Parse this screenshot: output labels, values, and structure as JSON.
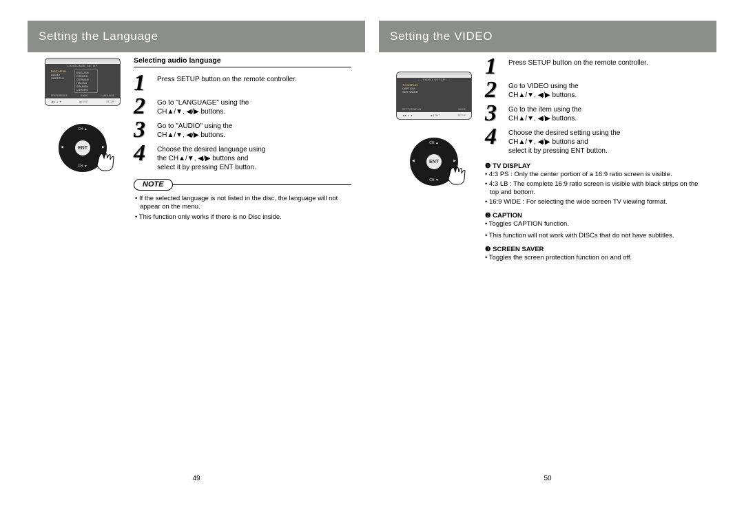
{
  "left": {
    "title": "Setting the Language",
    "screenTitle": "LANGUAGE SETUP",
    "screenMenu": [
      "DISC MENU",
      "AUDIO",
      "SUBTITLE"
    ],
    "screenSub": [
      "ENGLISH",
      "FRENCH",
      "GERMAN",
      "ITALIAN",
      "SPANISH",
      "OTHERS"
    ],
    "screenFoot": [
      "PREFERENCE",
      "AUDIO",
      "LANGUAGE"
    ],
    "screenFoot2Left": "◀ ▶ ▲ ▼",
    "screenFoot2Mid": "▶II  ENT",
    "screenFoot2Right": "SETUP",
    "dpadEnt": "ENT",
    "dpadUp": "CH ▲",
    "dpadDn": "CH ▼",
    "dpadLf": "◀",
    "dpadRt": "▶",
    "selHeading": "Selecting audio language",
    "step1": "Press SETUP button on the remote controller.",
    "step2a": "Go to \"LANGUAGE\" using the",
    "step2b": "CH▲/▼, ◀/▶  buttons.",
    "step3a": "Go to \"AUDIO\" using the",
    "step3b": "CH▲/▼, ◀/▶  buttons.",
    "step4a": "Choose the desired language using",
    "step4b": "the  CH▲/▼, ◀/▶  buttons and",
    "step4c": "select it by  pressing  ENT  button.",
    "noteLabel": "NOTE",
    "note1": "If the selected language is not listed in the disc, the language will not appear on the menu.",
    "note2": "This function only works if there is no Disc inside.",
    "pageNum": "49"
  },
  "right": {
    "title": "Setting the VIDEO",
    "screenTitle": "- - VIDEO SETUP - -",
    "screenMenu": [
      "TV DISPLAY",
      "CAPTION",
      "SCR SAVER"
    ],
    "screenFootLeft": "SET   TV   DISPLAY",
    "screenFootMid": "MODE",
    "screenFoot2Left": "◀ ▶ ▲ ▼",
    "screenFoot2Mid": "▶II  ENT",
    "screenFoot2Right": "SETUP",
    "dpadEnt": "ENT",
    "dpadUp": "CH ▲",
    "dpadDn": "CH ▼",
    "dpadLf": "◀",
    "dpadRt": "▶",
    "step1": "Press SETUP button on the remote controller.",
    "step2a": "Go to VIDEO using the",
    "step2b": "CH▲/▼, ◀/▶  buttons.",
    "step3a": "Go to the item using the",
    "step3b": "CH▲/▼, ◀/▶  buttons.",
    "step4a": "Choose the desired setting using the",
    "step4b": "CH▲/▼, ◀/▶  buttons and",
    "step4c": "select it by  pressing  ENT  button.",
    "def1h": "❶ TV DISPLAY",
    "def1a": "4:3 PS : Only the center portion of a 16:9 ratio screen is visible.",
    "def1b": "4:3 LB : The complete 16:9 ratio screen is visible with black strips on the top and bottom.",
    "def1c": "16:9 WIDE : For selecting the wide screen TV viewing format.",
    "def2h": "❷ CAPTION",
    "def2a": "Toggles CAPTION function.",
    "def2b": "This function will not work with DISCs that do not have subtitles.",
    "def3h": "❸ SCREEN SAVER",
    "def3a": "Toggles the screen protection function on and off.",
    "pageNum": "50"
  }
}
